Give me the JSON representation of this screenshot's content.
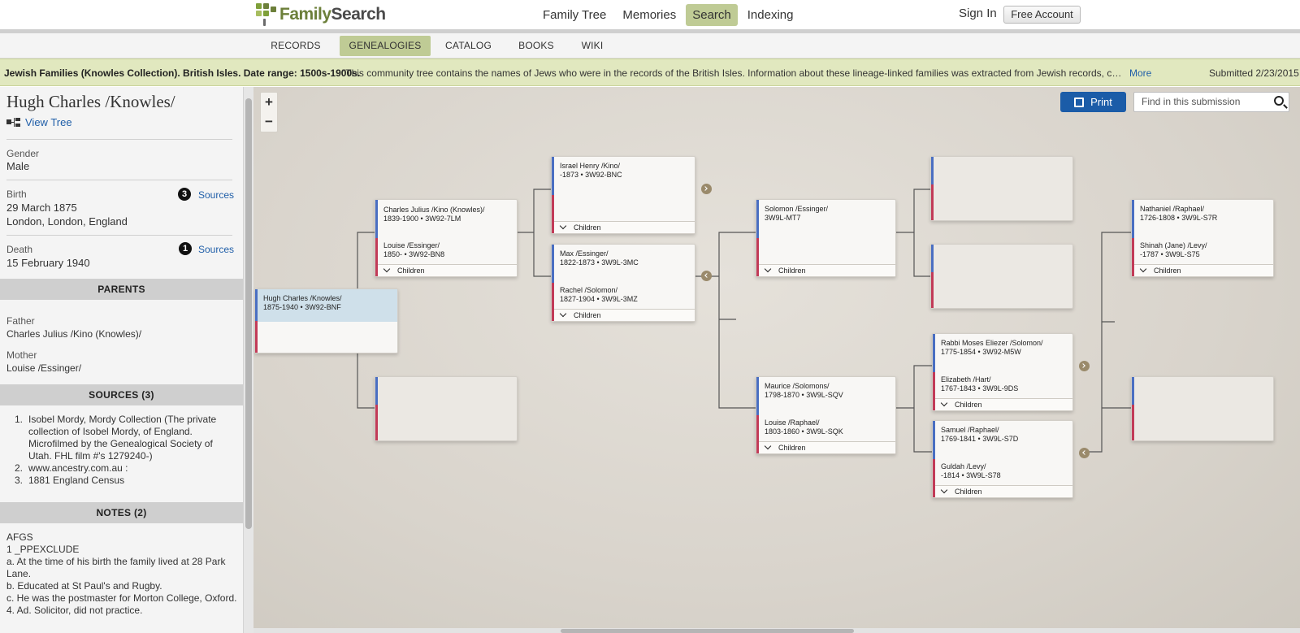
{
  "header": {
    "logo_text_1": "Family",
    "logo_text_2": "Search",
    "nav": [
      "Family Tree",
      "Memories",
      "Search",
      "Indexing"
    ],
    "nav_active": "Search",
    "sign_in": "Sign In",
    "free_account": "Free Account",
    "accent_color": "#bfcb95"
  },
  "subnav": [
    "RECORDS",
    "GENEALOGIES",
    "CATALOG",
    "BOOKS",
    "WIKI"
  ],
  "subnav_active": "GENEALOGIES",
  "banner": {
    "title": "Jewish Families (Knowles Collection). British Isles. Date range: 1500s-1900s.",
    "description": "\"This community tree contains the names of Jews who were in the records of the British Isles. Information about these lineage-linked families was extracted from Jewish records, civil re...",
    "more": "More",
    "submitted": "Submitted 2/23/2015"
  },
  "person": {
    "name": "Hugh Charles /Knowles/",
    "view_tree": "View Tree",
    "gender_label": "Gender",
    "gender": "Male",
    "birth_label": "Birth",
    "birth_date": "29 March 1875",
    "birth_place": "London, London, England",
    "birth_source_count": "3",
    "death_label": "Death",
    "death_date": "15 February 1940",
    "death_source_count": "1",
    "sources_link": "Sources"
  },
  "parents": {
    "header": "PARENTS",
    "father_label": "Father",
    "father": "Charles Julius /Kino (Knowles)/",
    "mother_label": "Mother",
    "mother": "Louise /Essinger/"
  },
  "sources": {
    "header": "SOURCES (3)",
    "items": [
      "Isobel Mordy, Mordy Collection (The private collection of Isobel Mordy, of England. Microfilmed by the Genealogical Society of Utah. FHL film #'s 1279240-)",
      "www.ancestry.com.au :",
      "1881 England Census"
    ]
  },
  "notes": {
    "header": "NOTES (2)",
    "lines": [
      "AFGS",
      "1 _PPEXCLUDE",
      "a. At the time of his birth the family lived at 28 Park Lane.",
      "b. Educated at St Paul's and Rugby.",
      "c. He was the postmaster for Morton College, Oxford.",
      "4. Ad. Solicitor, did not practice."
    ]
  },
  "toolbar": {
    "zoom_in": "+",
    "zoom_out": "−",
    "print": "Print",
    "find_placeholder": "Find in this submission"
  },
  "tree": {
    "children_label": "Children",
    "root": {
      "name": "Hugh Charles /Knowles/",
      "info": "1875-1940 • 3W92-BNF"
    },
    "gen1": {
      "father": {
        "name": "Charles Julius /Kino (Knowles)/",
        "info": "1839-1900 • 3W92-7LM"
      },
      "mother": {
        "name": "Louise /Essinger/",
        "info": "1850- • 3W92-BN8"
      }
    },
    "gen2_a": {
      "father": {
        "name": "Israel Henry /Kino/",
        "info": "-1873 • 3W92-BNC"
      }
    },
    "gen2_b": {
      "father": {
        "name": "Max /Essinger/",
        "info": "1822-1873 • 3W9L-3MC"
      },
      "mother": {
        "name": "Rachel /Solomon/",
        "info": "1827-1904 • 3W9L-3MZ"
      }
    },
    "gen3_a": {
      "father": {
        "name": "Solomon /Essinger/",
        "info": "3W9L-MT7"
      }
    },
    "gen3_b": {
      "father": {
        "name": "Maurice /Solomons/",
        "info": "1798-1870 • 3W9L-SQV"
      },
      "mother": {
        "name": "Louise /Raphael/",
        "info": "1803-1860 • 3W9L-SQK"
      }
    },
    "gen4_a": {
      "father": {
        "name": "Rabbi Moses Eliezer /Solomon/",
        "info": "1775-1854 • 3W92-M5W"
      },
      "mother": {
        "name": "Elizabeth /Hart/",
        "info": "1767-1843 • 3W9L-9DS"
      }
    },
    "gen4_b": {
      "father": {
        "name": "Samuel /Raphael/",
        "info": "1769-1841 • 3W9L-S7D"
      },
      "mother": {
        "name": "Guldah /Levy/",
        "info": "-1814 • 3W9L-S78"
      }
    },
    "gen5_a": {
      "father": {
        "name": "Nathaniel /Raphael/",
        "info": "1726-1808 • 3W9L-S7R"
      },
      "mother": {
        "name": "Shinah (Jane) /Levy/",
        "info": "-1787 • 3W9L-S75"
      }
    }
  }
}
